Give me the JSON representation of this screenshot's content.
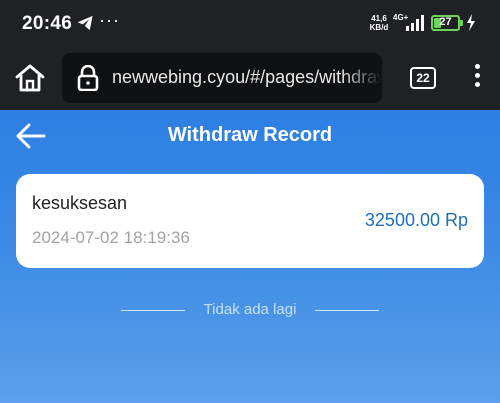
{
  "status_bar": {
    "time": "20:46",
    "overflow_indicator": "···",
    "net_speed_value": "41,6",
    "net_speed_unit": "KB/d",
    "network_type": "4G+",
    "battery_level": "27",
    "icons": [
      "telegram-icon",
      "signal-icon",
      "battery-icon",
      "charging-bolt-icon"
    ]
  },
  "browser": {
    "url": "newwebing.cyou/#/pages/withdrawalRecord",
    "tab_count": "22",
    "icons": [
      "home-icon",
      "lock-icon",
      "more-vertical-icon"
    ]
  },
  "page": {
    "title": "Withdraw Record",
    "back_icon": "arrow-left-icon",
    "records": [
      {
        "status": "kesuksesan",
        "time": "2024-07-02 18:19:36",
        "amount": "32500.00 Rp"
      }
    ],
    "end_text": "Tidak ada lagi"
  },
  "colors": {
    "status_bar_bg": "#1f2124",
    "page_gradient_top": "#2d7fe2",
    "page_gradient_bottom": "#5aa0ea",
    "amount_text": "#1f6fb8",
    "battery": "#6fd55a"
  }
}
